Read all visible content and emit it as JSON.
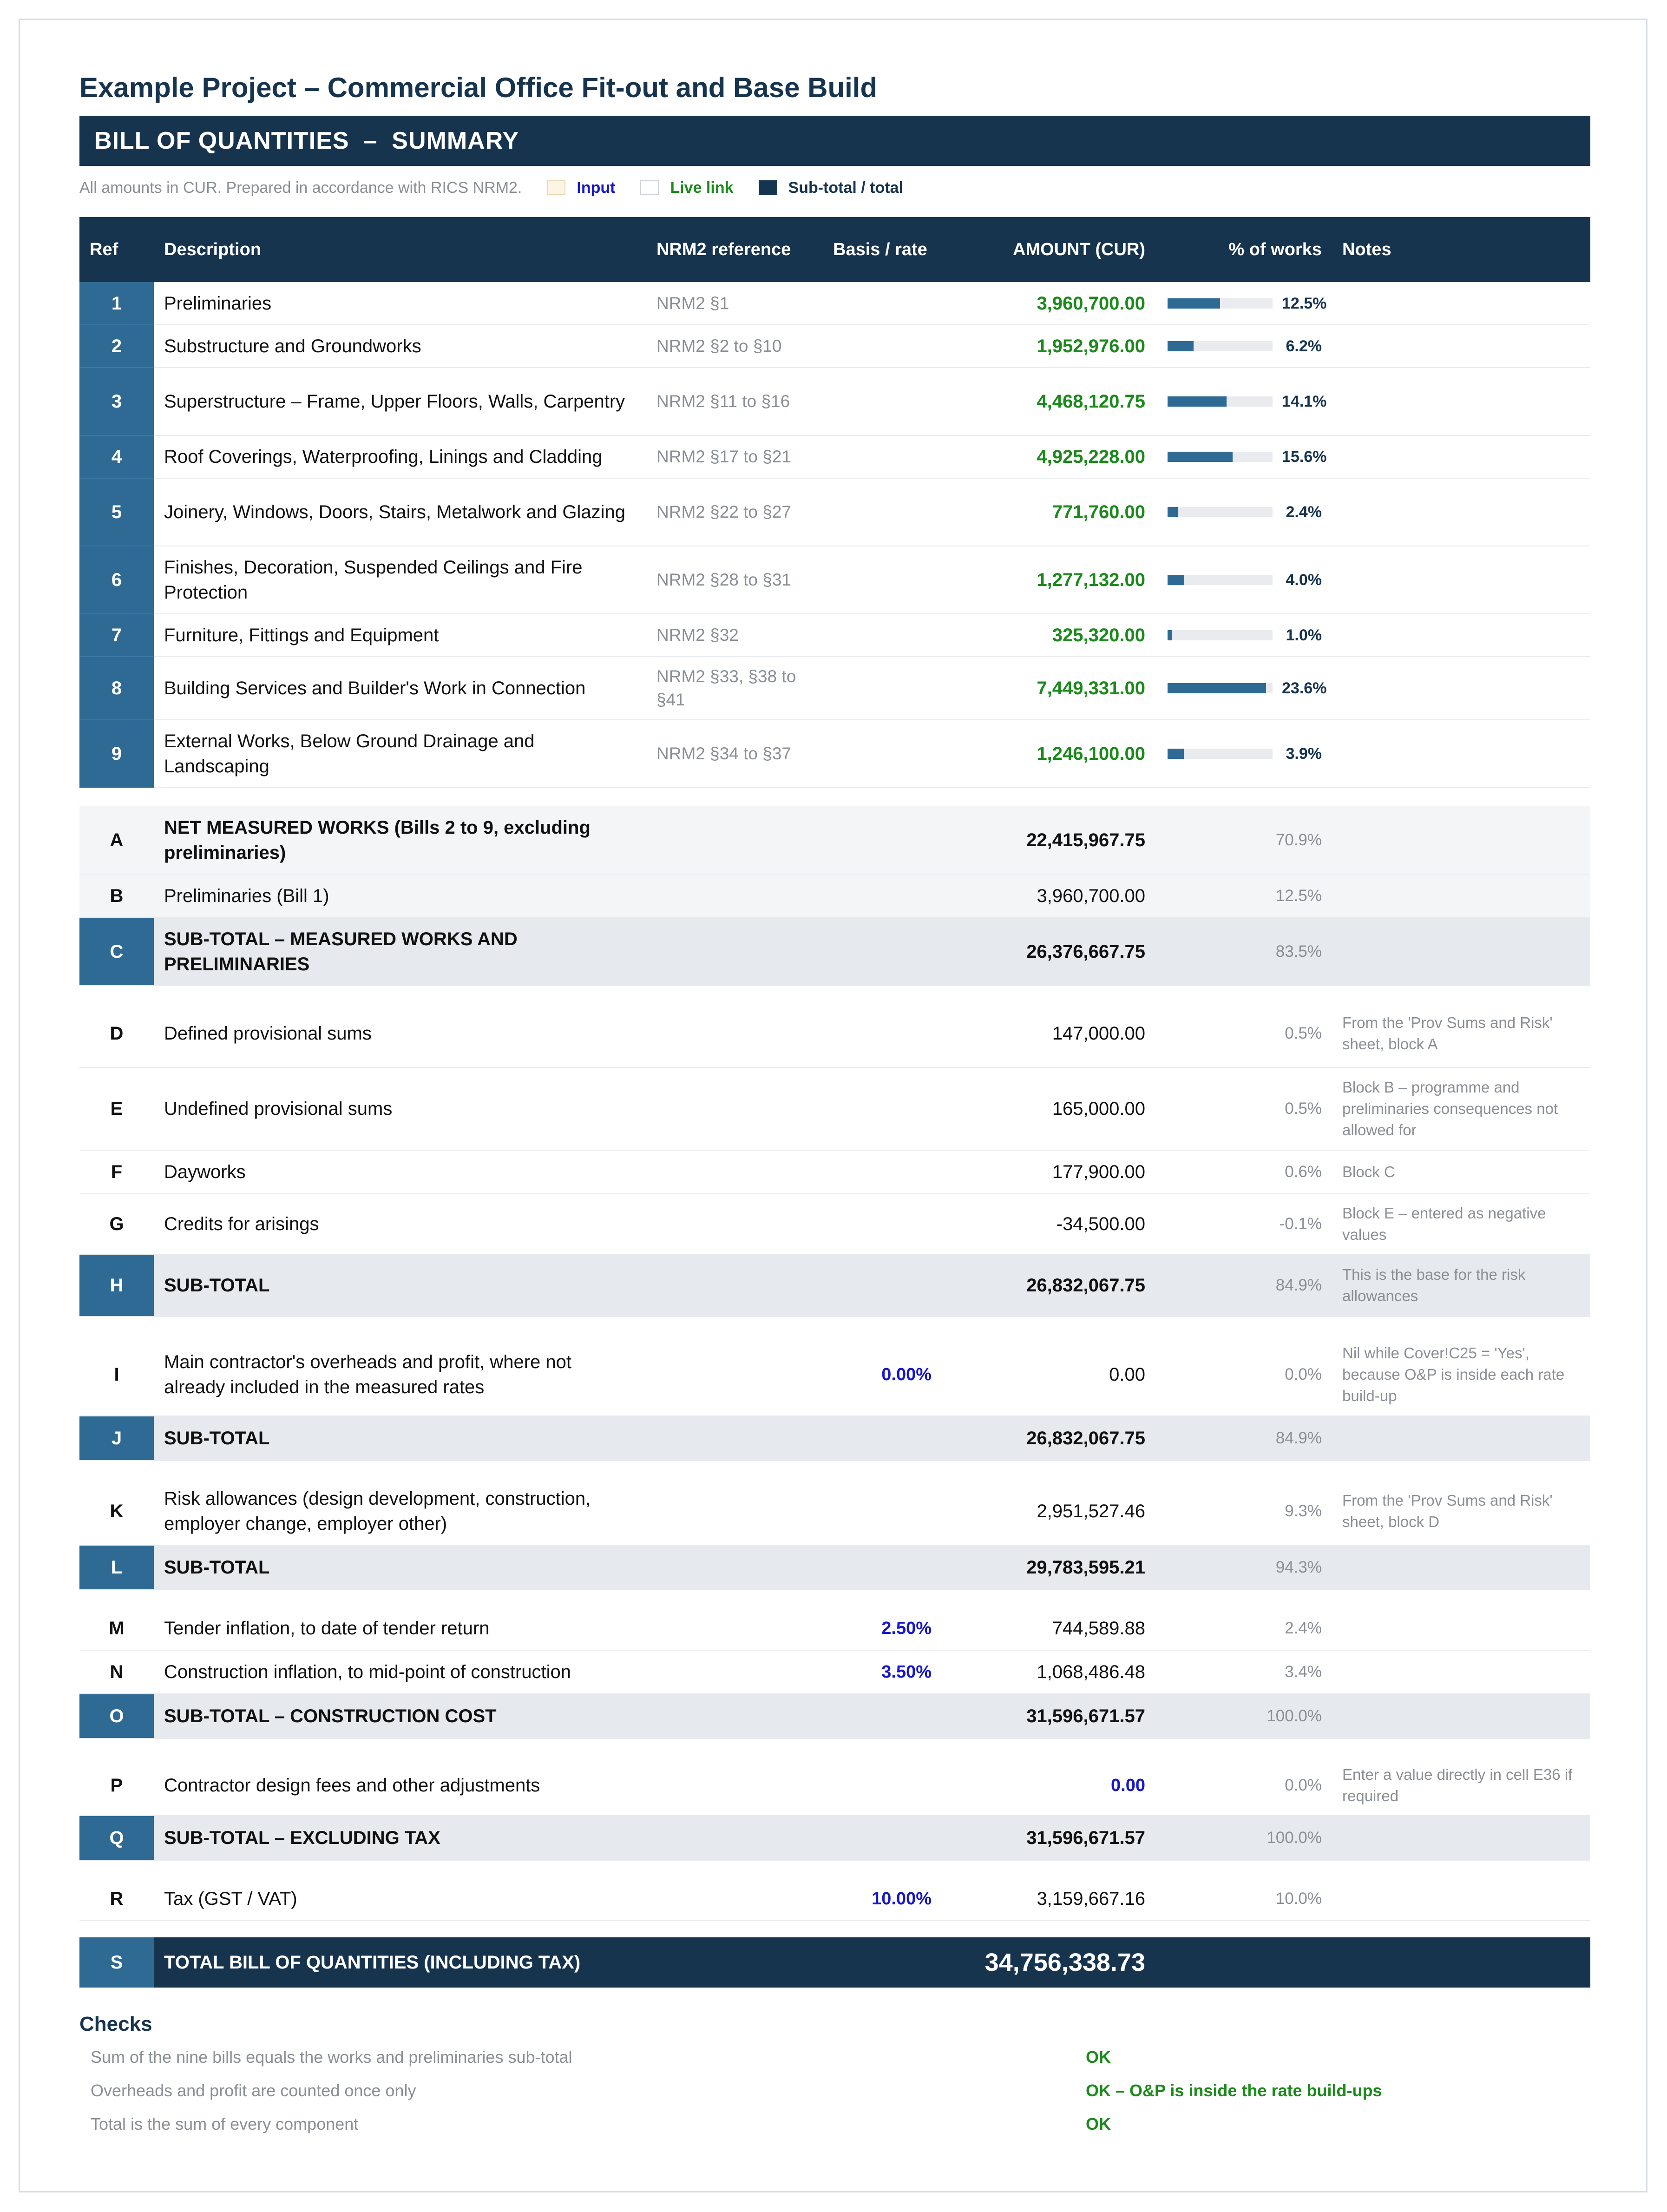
{
  "project_title": "Example Project – Commercial Office Fit-out and Base Build",
  "band_title": "BILL OF QUANTITIES  –  SUMMARY",
  "legend": {
    "note": "All amounts in CUR.   Prepared in accordance with RICS NRM2.",
    "input": "Input",
    "live_link": "Live link",
    "subtotal": "Sub-total / total",
    "colors": {
      "input": "#fdf5e4",
      "live_link": "#ffffff",
      "subtotal": "#17344f"
    }
  },
  "columns": {
    "ref": "Ref",
    "description": "Description",
    "nrm2": "NRM2 reference",
    "basis": "Basis / rate",
    "amount": "AMOUNT (CUR)",
    "pct": "% of works",
    "notes": "Notes"
  },
  "bills": [
    {
      "ref": "1",
      "description": "Preliminaries",
      "nrm2": "NRM2 §1",
      "amount": "3,960,700.00",
      "pct": "12.5%",
      "share": 12.5
    },
    {
      "ref": "2",
      "description": "Substructure and Groundworks",
      "nrm2": "NRM2 §2 to §10",
      "amount": "1,952,976.00",
      "pct": "6.2%",
      "share": 6.2
    },
    {
      "ref": "3",
      "description": "Superstructure – Frame, Upper Floors, Walls, Carpentry",
      "nrm2": "NRM2 §11 to §16",
      "amount": "4,468,120.75",
      "pct": "14.1%",
      "share": 14.1
    },
    {
      "ref": "4",
      "description": "Roof Coverings, Waterproofing, Linings and Cladding",
      "nrm2": "NRM2 §17 to §21",
      "amount": "4,925,228.00",
      "pct": "15.6%",
      "share": 15.6
    },
    {
      "ref": "5",
      "description": "Joinery, Windows, Doors, Stairs, Metalwork and Glazing",
      "nrm2": "NRM2 §22 to §27",
      "amount": "771,760.00",
      "pct": "2.4%",
      "share": 2.4
    },
    {
      "ref": "6",
      "description": "Finishes, Decoration, Suspended Ceilings and Fire Protection",
      "nrm2": "NRM2 §28 to §31",
      "amount": "1,277,132.00",
      "pct": "4.0%",
      "share": 4.0
    },
    {
      "ref": "7",
      "description": "Furniture, Fittings and Equipment",
      "nrm2": "NRM2 §32",
      "amount": "325,320.00",
      "pct": "1.0%",
      "share": 1.0
    },
    {
      "ref": "8",
      "description": "Building Services and Builder's Work in Connection",
      "nrm2": "NRM2 §33, §38 to §41",
      "amount": "7,449,331.00",
      "pct": "23.6%",
      "share": 23.6
    },
    {
      "ref": "9",
      "description": "External Works, Below Ground Drainage and Landscaping",
      "nrm2": "NRM2 §34 to §37",
      "amount": "1,246,100.00",
      "pct": "3.9%",
      "share": 3.9
    }
  ],
  "rows": {
    "A": {
      "ref": "A",
      "description": "NET MEASURED WORKS (Bills 2 to 9, excluding preliminaries)",
      "amount": "22,415,967.75",
      "pct": "70.9%"
    },
    "B": {
      "ref": "B",
      "description": "Preliminaries (Bill 1)",
      "amount": "3,960,700.00",
      "pct": "12.5%"
    },
    "C": {
      "ref": "C",
      "description": "SUB-TOTAL – MEASURED WORKS AND PRELIMINARIES",
      "amount": "26,376,667.75",
      "pct": "83.5%"
    },
    "D": {
      "ref": "D",
      "description": "Defined provisional sums",
      "amount": "147,000.00",
      "pct": "0.5%",
      "note": "From the 'Prov Sums and Risk' sheet, block A"
    },
    "E": {
      "ref": "E",
      "description": "Undefined provisional sums",
      "amount": "165,000.00",
      "pct": "0.5%",
      "note": "Block B – programme and preliminaries consequences not allowed for"
    },
    "F": {
      "ref": "F",
      "description": "Dayworks",
      "amount": "177,900.00",
      "pct": "0.6%",
      "note": "Block C"
    },
    "G": {
      "ref": "G",
      "description": "Credits for arisings",
      "amount": "-34,500.00",
      "pct": "-0.1%",
      "note": "Block E – entered as negative values"
    },
    "H": {
      "ref": "H",
      "description": "SUB-TOTAL",
      "amount": "26,832,067.75",
      "pct": "84.9%",
      "note": "This is the base for the risk allowances"
    },
    "I": {
      "ref": "I",
      "description": "Main contractor's overheads and profit, where not already included in the measured rates",
      "rate": "0.00%",
      "amount": "0.00",
      "pct": "0.0%",
      "note": "Nil while Cover!C25 = 'Yes', because O&P is inside each rate build-up"
    },
    "J": {
      "ref": "J",
      "description": "SUB-TOTAL",
      "amount": "26,832,067.75",
      "pct": "84.9%"
    },
    "K": {
      "ref": "K",
      "description": "Risk allowances (design development, construction, employer change, employer other)",
      "amount": "2,951,527.46",
      "pct": "9.3%",
      "note": "From the 'Prov Sums and Risk' sheet, block D"
    },
    "L": {
      "ref": "L",
      "description": "SUB-TOTAL",
      "amount": "29,783,595.21",
      "pct": "94.3%"
    },
    "M": {
      "ref": "M",
      "description": "Tender inflation, to date of tender return",
      "rate": "2.50%",
      "amount": "744,589.88",
      "pct": "2.4%"
    },
    "N": {
      "ref": "N",
      "description": "Construction inflation, to mid-point of construction",
      "rate": "3.50%",
      "amount": "1,068,486.48",
      "pct": "3.4%"
    },
    "O": {
      "ref": "O",
      "description": "SUB-TOTAL – CONSTRUCTION COST",
      "amount": "31,596,671.57",
      "pct": "100.0%"
    },
    "P": {
      "ref": "P",
      "description": "Contractor design fees and other adjustments",
      "amount": "0.00",
      "pct": "0.0%",
      "note": "Enter a value directly in cell E36 if required"
    },
    "Q": {
      "ref": "Q",
      "description": "SUB-TOTAL – EXCLUDING TAX",
      "amount": "31,596,671.57",
      "pct": "100.0%"
    },
    "R": {
      "ref": "R",
      "description": "Tax (GST / VAT)",
      "rate": "10.00%",
      "amount": "3,159,667.16",
      "pct": "10.0%"
    },
    "S": {
      "ref": "S",
      "description": "TOTAL BILL OF QUANTITIES (INCLUDING TAX)",
      "amount": "34,756,338.73"
    }
  },
  "checks": {
    "title": "Checks",
    "items": [
      {
        "label": "Sum of the nine bills equals the works and preliminaries sub-total",
        "result": "OK"
      },
      {
        "label": "Overheads and profit are counted once only",
        "result": "OK – O&P is inside the rate build-ups"
      },
      {
        "label": "Total is the sum of every component",
        "result": "OK"
      }
    ]
  }
}
